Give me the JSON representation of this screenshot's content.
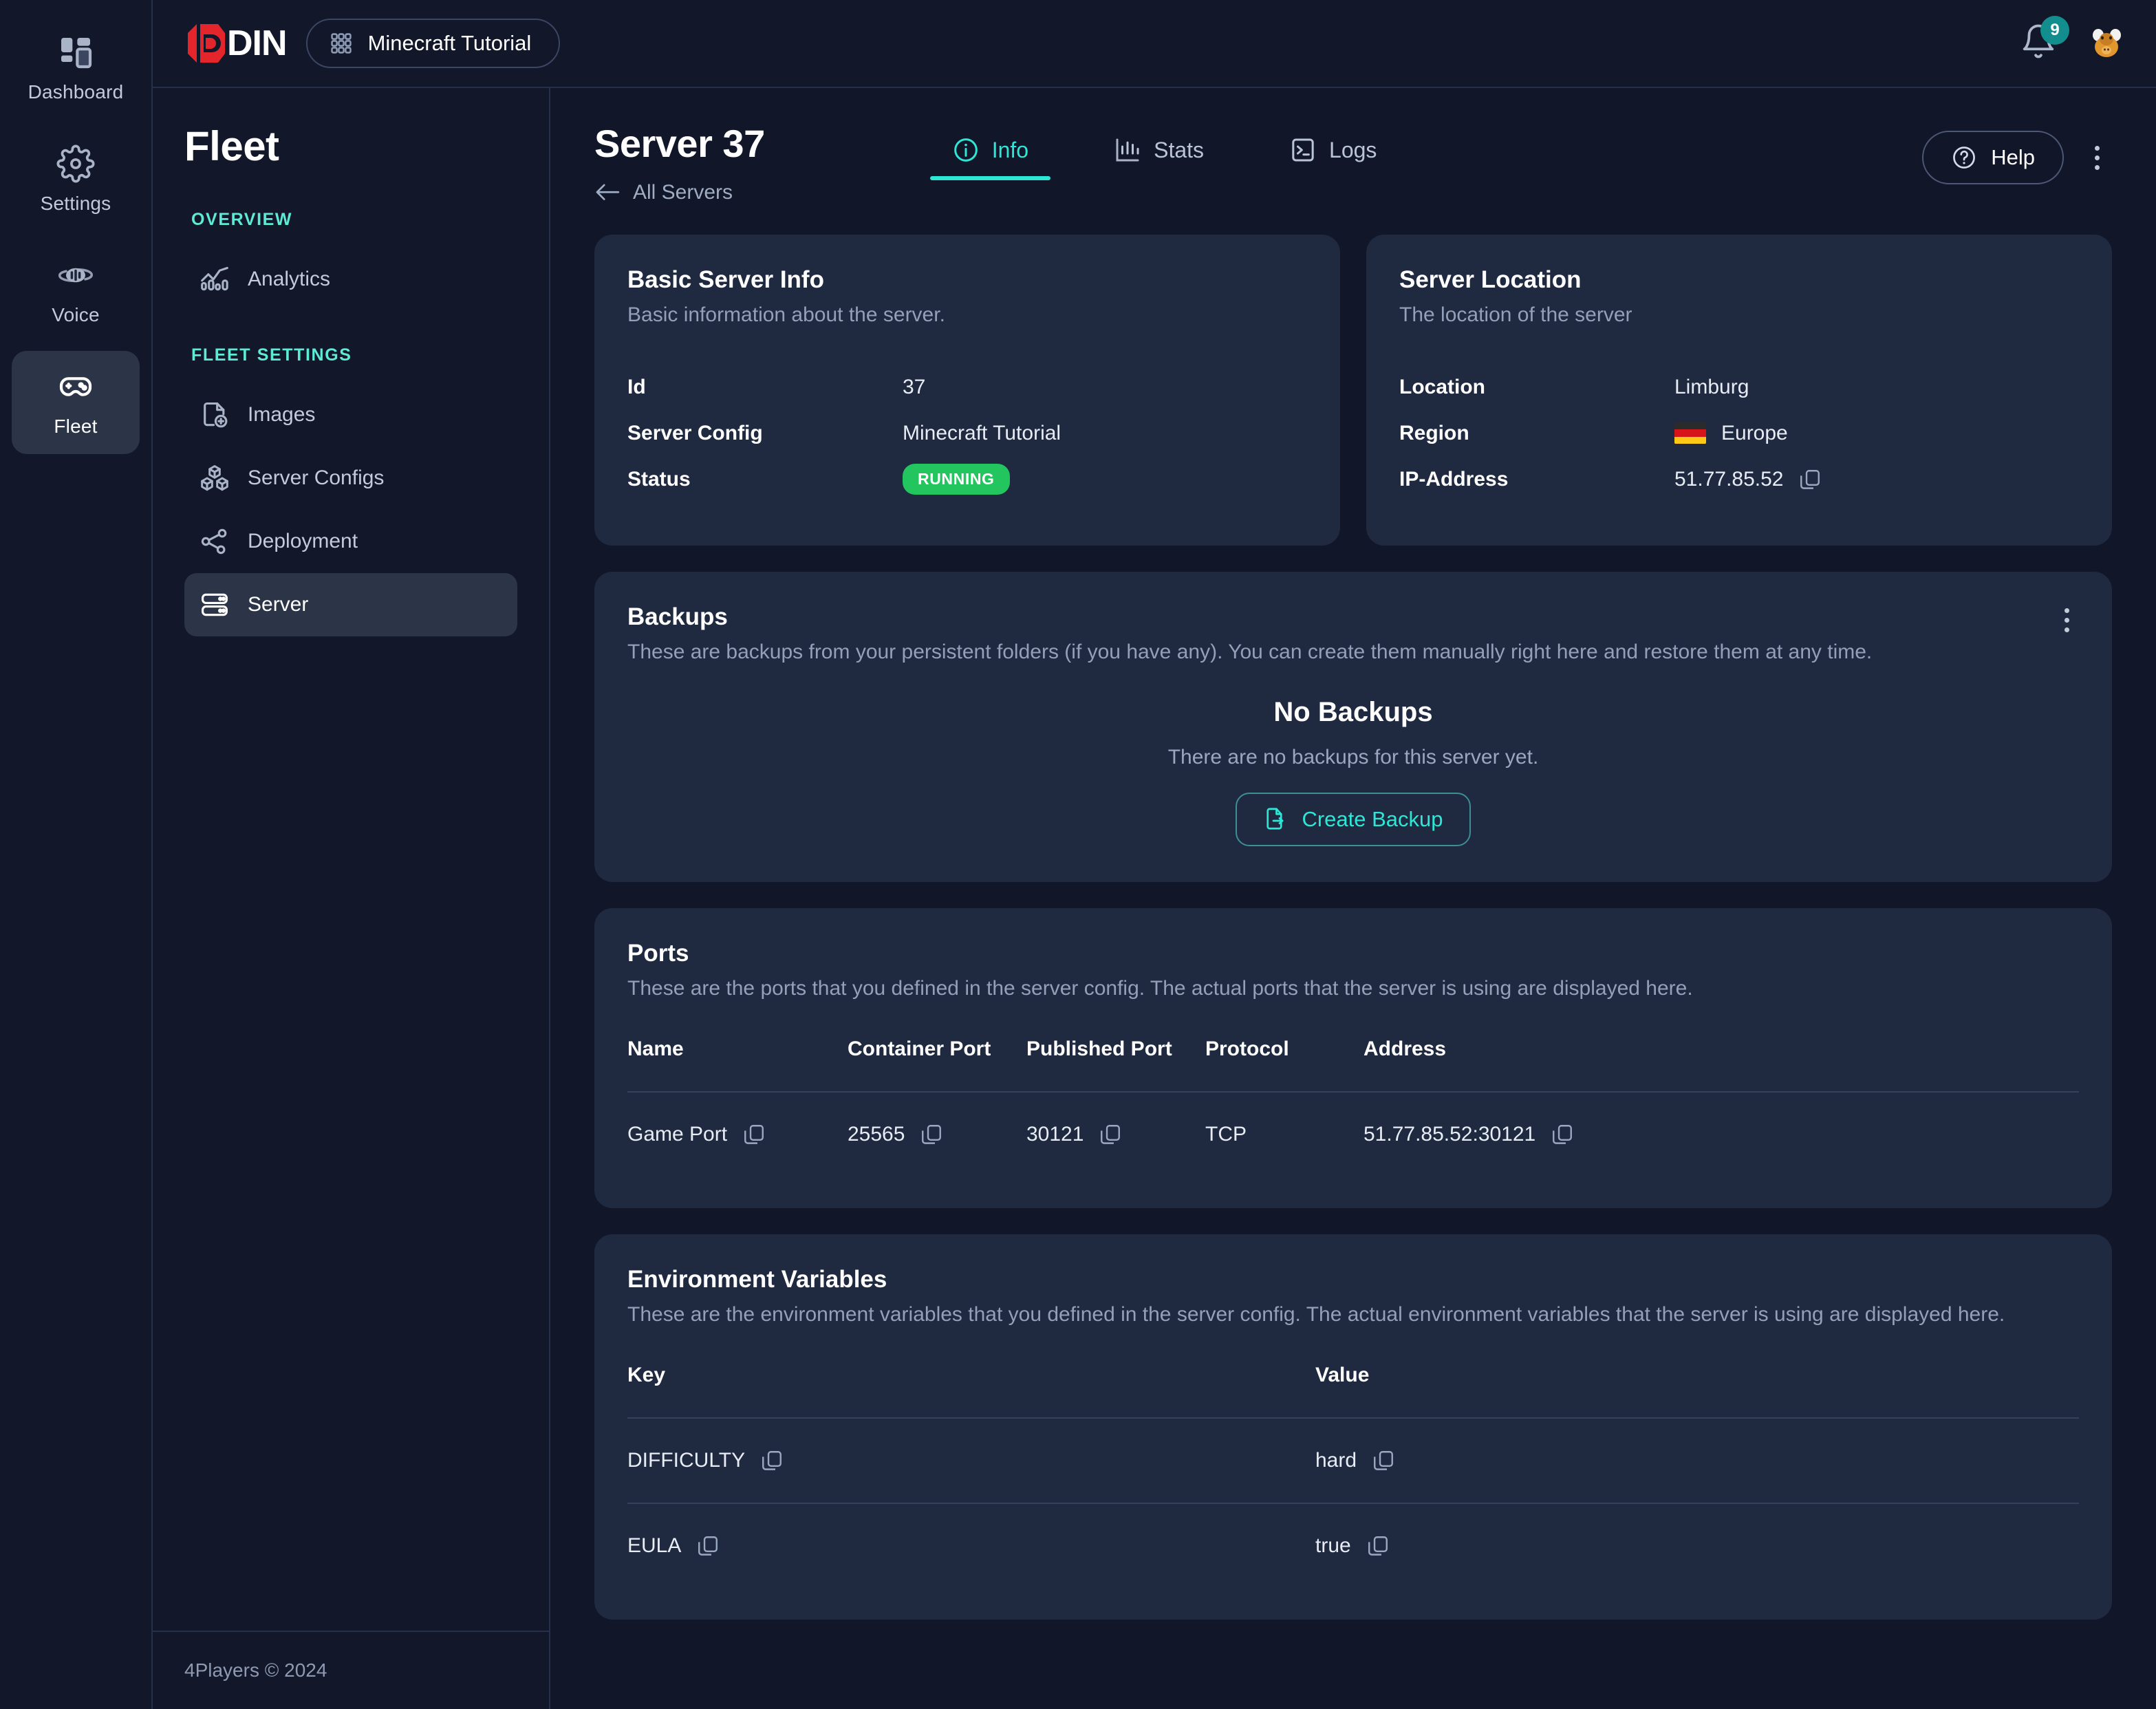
{
  "rail": {
    "items": [
      {
        "label": "Dashboard",
        "icon": "dashboard-icon",
        "active": false
      },
      {
        "label": "Settings",
        "icon": "gear-icon",
        "active": false
      },
      {
        "label": "Voice",
        "icon": "voice-icon",
        "active": false
      },
      {
        "label": "Fleet",
        "icon": "gamepad-icon",
        "active": true
      }
    ]
  },
  "topbar": {
    "logo_text": "DIN",
    "context_label": "Minecraft Tutorial",
    "context_icon": "grid-icon",
    "bell_icon": "bell-icon",
    "notification_count": "9",
    "avatar_icon": "avatar-moose"
  },
  "sidebar": {
    "title": "Fleet",
    "groups": [
      {
        "label": "OVERVIEW",
        "items": [
          {
            "label": "Analytics",
            "icon": "analytics-icon",
            "active": false
          }
        ]
      },
      {
        "label": "FLEET SETTINGS",
        "items": [
          {
            "label": "Images",
            "icon": "image-add-icon",
            "active": false
          },
          {
            "label": "Server Configs",
            "icon": "boxes-icon",
            "active": false
          },
          {
            "label": "Deployment",
            "icon": "share-nodes-icon",
            "active": false
          },
          {
            "label": "Server",
            "icon": "server-icon",
            "active": true
          }
        ]
      }
    ],
    "footer": "4Players © 2024"
  },
  "header": {
    "title": "Server 37",
    "back_label": "All Servers",
    "back_icon": "arrow-left-icon",
    "tabs": [
      {
        "label": "Info",
        "icon": "info-circle-icon",
        "active": true
      },
      {
        "label": "Stats",
        "icon": "bar-chart-icon",
        "active": false
      },
      {
        "label": "Logs",
        "icon": "terminal-icon",
        "active": false
      }
    ],
    "help_label": "Help",
    "help_icon": "question-circle-icon",
    "menu_icon": "kebab-menu-icon"
  },
  "basic_info": {
    "title": "Basic Server Info",
    "subtitle": "Basic information about the server.",
    "rows": [
      {
        "key": "Id",
        "value": "37"
      },
      {
        "key": "Server Config",
        "value": "Minecraft Tutorial"
      },
      {
        "key": "Status",
        "value": "RUNNING"
      }
    ],
    "status_color": "#22c55e"
  },
  "location": {
    "title": "Server Location",
    "subtitle": "The location of the server",
    "rows": [
      {
        "key": "Location",
        "value": "Limburg"
      },
      {
        "key": "Region",
        "value": "Europe"
      },
      {
        "key": "IP-Address",
        "value": "51.77.85.52"
      }
    ],
    "flag": "germany-flag",
    "copy_icon": "copy-icon"
  },
  "backups": {
    "title": "Backups",
    "subtitle": "These are backups from your persistent folders (if you have any). You can create them manually right here and restore them at any time.",
    "empty_title": "No Backups",
    "empty_sub": "There are no backups for this server yet.",
    "create_label": "Create Backup",
    "create_icon": "file-export-icon",
    "menu_icon": "kebab-menu-icon"
  },
  "ports": {
    "title": "Ports",
    "subtitle": "These are the ports that you defined in the server config. The actual ports that the server is using are displayed here.",
    "columns": [
      "Name",
      "Container Port",
      "Published Port",
      "Protocol",
      "Address"
    ],
    "rows": [
      {
        "name": "Game Port",
        "container_port": "25565",
        "published_port": "30121",
        "protocol": "TCP",
        "address": "51.77.85.52:30121"
      }
    ]
  },
  "env": {
    "title": "Environment Variables",
    "subtitle": "These are the environment variables that you defined in the server config. The actual environment variables that the server is using are displayed here.",
    "columns": [
      "Key",
      "Value"
    ],
    "rows": [
      {
        "key": "DIFFICULTY",
        "value": "hard"
      },
      {
        "key": "EULA",
        "value": "true"
      }
    ]
  },
  "colors": {
    "page_bg": "#111629",
    "card_bg": "#1f2940",
    "accent": "#2ee6d6",
    "accent_label": "#5eead4",
    "logo_red": "#e4262c",
    "status_green": "#22c55e",
    "badge_teal": "#138e8e"
  }
}
